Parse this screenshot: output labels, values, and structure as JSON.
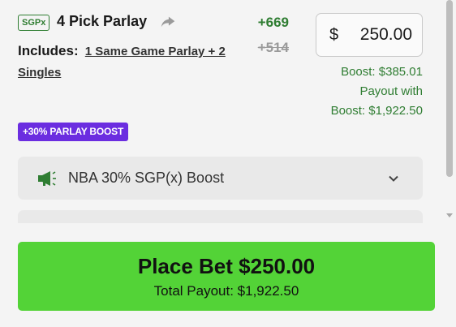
{
  "bet": {
    "badge": "SGPx",
    "title": "4 Pick Parlay",
    "odds": "+669",
    "original_odds": "+514",
    "includes_label": "Includes:",
    "includes_link": "1 Same Game Parlay + 2 Singles"
  },
  "wager": {
    "currency_symbol": "$",
    "value": "250.00"
  },
  "boost": {
    "boost_amount": "Boost: $385.01",
    "payout_line1": "Payout with",
    "payout_line2": "Boost: $1,922.50",
    "badge": "+30% PARLAY BOOST"
  },
  "promo": {
    "selected": "NBA 30% SGP(x) Boost",
    "icon": "megaphone-icon"
  },
  "place_bet": {
    "label": "Place Bet $250.00",
    "total_payout": "Total Payout: $1,922.50"
  },
  "colors": {
    "green_text": "#2f7d32",
    "boost_purple": "#6b2de0",
    "place_bet_green": "#53d337"
  }
}
